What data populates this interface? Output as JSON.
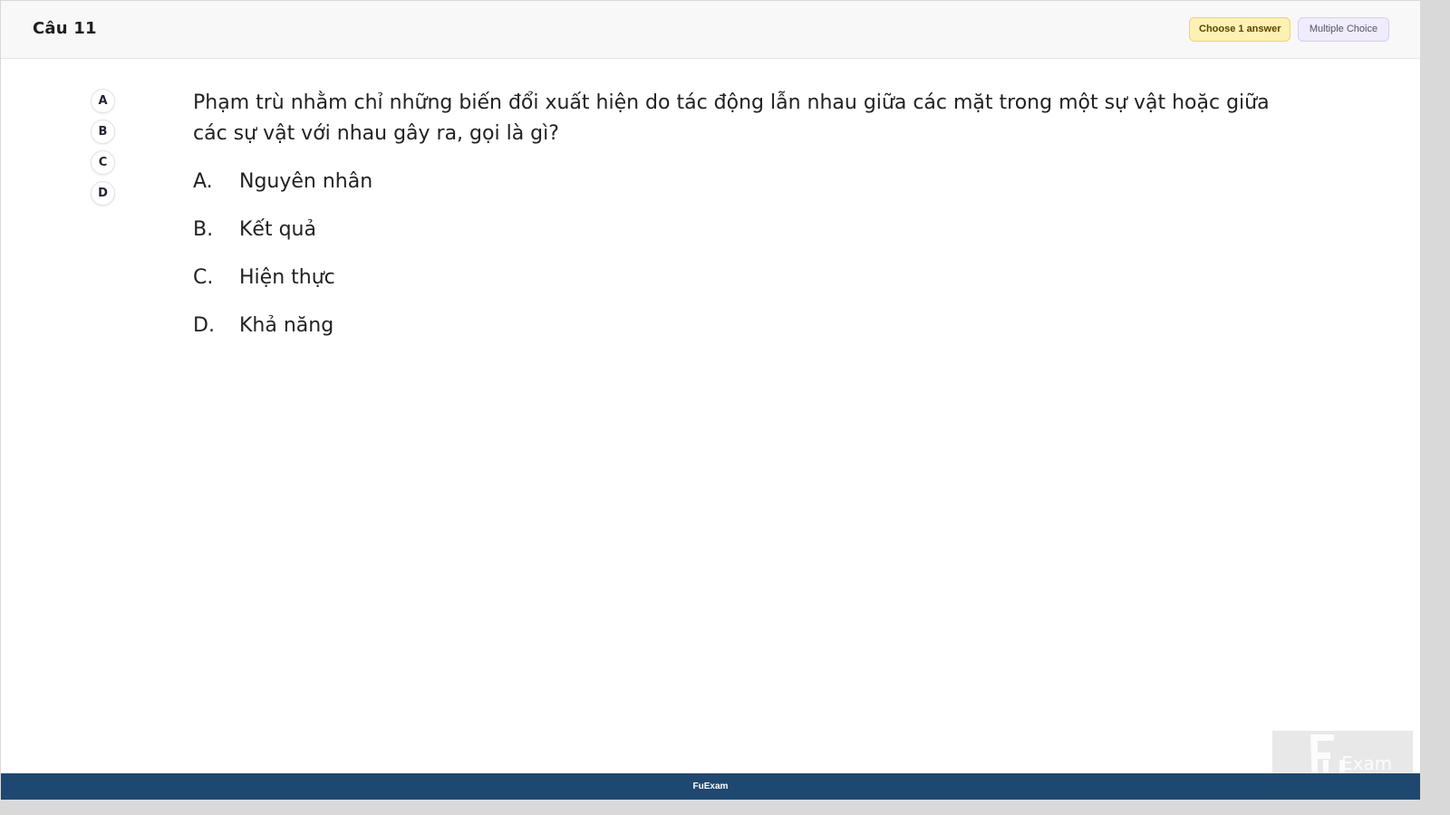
{
  "header": {
    "question_label": "Câu 11",
    "choose_badge": "Choose 1 answer",
    "type_badge": "Multiple Choice"
  },
  "option_nav": [
    "A",
    "B",
    "C",
    "D"
  ],
  "question": {
    "text": "Phạm trù nhằm chỉ những biến đổi xuất hiện do tác động lẫn nhau giữa các mặt trong một sự vật hoặc giữa các sự vật với nhau gây ra, gọi là gì?"
  },
  "answers": [
    {
      "letter": "A.",
      "text": "Nguyên nhân"
    },
    {
      "letter": "B.",
      "text": "Kết quả"
    },
    {
      "letter": "C.",
      "text": "Hiện thực"
    },
    {
      "letter": "D.",
      "text": "Khả năng"
    }
  ],
  "footer": {
    "brand": "FuExam"
  },
  "watermark": {
    "logo": "FU Exam"
  },
  "colors": {
    "footer_bg": "#1e4870",
    "choose_badge_bg": "#fdf1b3",
    "type_badge_bg": "#f0ecfb"
  }
}
